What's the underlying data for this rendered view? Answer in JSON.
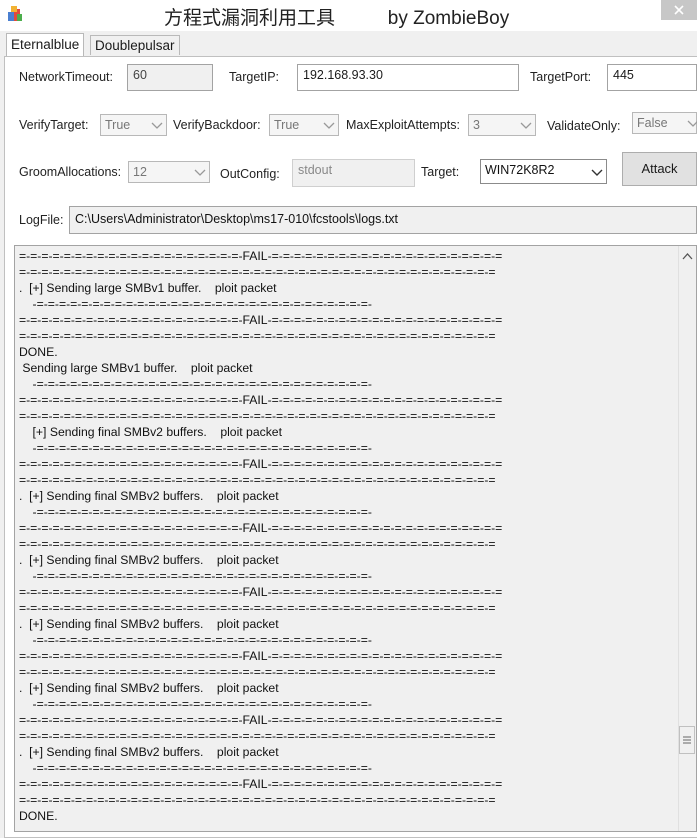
{
  "window": {
    "title": "方程式漏洞利用工具          by ZombieBoy"
  },
  "tabs": [
    {
      "label": "Eternalblue",
      "active": true
    },
    {
      "label": "Doublepulsar",
      "active": false
    }
  ],
  "form": {
    "network_timeout": {
      "label": "NetworkTimeout:",
      "value": "60"
    },
    "target_ip": {
      "label": "TargetIP:",
      "value": "192.168.93.30"
    },
    "target_port": {
      "label": "TargetPort:",
      "value": "445"
    },
    "verify_target": {
      "label": "VerifyTarget:",
      "value": "True"
    },
    "verify_backdoor": {
      "label": "VerifyBackdoor:",
      "value": "True"
    },
    "max_exploit_attempts": {
      "label": "MaxExploitAttempts:",
      "value": "3"
    },
    "validate_only": {
      "label": "ValidateOnly:",
      "value": "False"
    },
    "groom_allocations": {
      "label": "GroomAllocations:",
      "value": "12"
    },
    "out_config": {
      "label": "OutConfig:",
      "value": "stdout"
    },
    "target": {
      "label": "Target:",
      "value": "WIN72K8R2"
    },
    "attack_label": "Attack",
    "logfile": {
      "label": "LogFile:",
      "value": "C:\\Users\\Administrator\\Desktop\\ms17-010\\fcstools\\logs.txt"
    }
  },
  "log": {
    "lines": [
      "=-=-=-=-=-=-=-=-=-=-=-=-=-=-=-=-=-=-=-=-FAIL-=-=-=-=-=-=-=-=-=-=-=-=-=-=-=-=-=-=-=-=-=",
      "=-=-=-=-=-=-=-=-=-=-=-=-=-=-=-=-=-=-=-=-=-=-=-=-=-=-=-=-=-=-=-=-=-=-=-=-=-=-=-=-=-=-=",
      ".  [+] Sending large SMBv1 buffer.    ploit packet",
      "    -=-=-=-=-=-=-=-=-=-=-=-=-=-=-=-=-=-=-=-=-=-=-=-=-=-=-=-=-=-=-",
      "=-=-=-=-=-=-=-=-=-=-=-=-=-=-=-=-=-=-=-=-FAIL-=-=-=-=-=-=-=-=-=-=-=-=-=-=-=-=-=-=-=-=-=",
      "=-=-=-=-=-=-=-=-=-=-=-=-=-=-=-=-=-=-=-=-=-=-=-=-=-=-=-=-=-=-=-=-=-=-=-=-=-=-=-=-=-=-=",
      "DONE.",
      " Sending large SMBv1 buffer.    ploit packet",
      "    -=-=-=-=-=-=-=-=-=-=-=-=-=-=-=-=-=-=-=-=-=-=-=-=-=-=-=-=-=-=-",
      "=-=-=-=-=-=-=-=-=-=-=-=-=-=-=-=-=-=-=-=-FAIL-=-=-=-=-=-=-=-=-=-=-=-=-=-=-=-=-=-=-=-=-=",
      "=-=-=-=-=-=-=-=-=-=-=-=-=-=-=-=-=-=-=-=-=-=-=-=-=-=-=-=-=-=-=-=-=-=-=-=-=-=-=-=-=-=-=",
      "    [+] Sending final SMBv2 buffers.    ploit packet",
      "    -=-=-=-=-=-=-=-=-=-=-=-=-=-=-=-=-=-=-=-=-=-=-=-=-=-=-=-=-=-=-",
      "=-=-=-=-=-=-=-=-=-=-=-=-=-=-=-=-=-=-=-=-FAIL-=-=-=-=-=-=-=-=-=-=-=-=-=-=-=-=-=-=-=-=-=",
      "=-=-=-=-=-=-=-=-=-=-=-=-=-=-=-=-=-=-=-=-=-=-=-=-=-=-=-=-=-=-=-=-=-=-=-=-=-=-=-=-=-=-=",
      ".  [+] Sending final SMBv2 buffers.    ploit packet",
      "    -=-=-=-=-=-=-=-=-=-=-=-=-=-=-=-=-=-=-=-=-=-=-=-=-=-=-=-=-=-=-",
      "=-=-=-=-=-=-=-=-=-=-=-=-=-=-=-=-=-=-=-=-FAIL-=-=-=-=-=-=-=-=-=-=-=-=-=-=-=-=-=-=-=-=-=",
      "=-=-=-=-=-=-=-=-=-=-=-=-=-=-=-=-=-=-=-=-=-=-=-=-=-=-=-=-=-=-=-=-=-=-=-=-=-=-=-=-=-=-=",
      ".  [+] Sending final SMBv2 buffers.    ploit packet",
      "    -=-=-=-=-=-=-=-=-=-=-=-=-=-=-=-=-=-=-=-=-=-=-=-=-=-=-=-=-=-=-",
      "=-=-=-=-=-=-=-=-=-=-=-=-=-=-=-=-=-=-=-=-FAIL-=-=-=-=-=-=-=-=-=-=-=-=-=-=-=-=-=-=-=-=-=",
      "=-=-=-=-=-=-=-=-=-=-=-=-=-=-=-=-=-=-=-=-=-=-=-=-=-=-=-=-=-=-=-=-=-=-=-=-=-=-=-=-=-=-=",
      ".  [+] Sending final SMBv2 buffers.    ploit packet",
      "    -=-=-=-=-=-=-=-=-=-=-=-=-=-=-=-=-=-=-=-=-=-=-=-=-=-=-=-=-=-=-",
      "=-=-=-=-=-=-=-=-=-=-=-=-=-=-=-=-=-=-=-=-FAIL-=-=-=-=-=-=-=-=-=-=-=-=-=-=-=-=-=-=-=-=-=",
      "=-=-=-=-=-=-=-=-=-=-=-=-=-=-=-=-=-=-=-=-=-=-=-=-=-=-=-=-=-=-=-=-=-=-=-=-=-=-=-=-=-=-=",
      ".  [+] Sending final SMBv2 buffers.    ploit packet",
      "    -=-=-=-=-=-=-=-=-=-=-=-=-=-=-=-=-=-=-=-=-=-=-=-=-=-=-=-=-=-=-",
      "=-=-=-=-=-=-=-=-=-=-=-=-=-=-=-=-=-=-=-=-FAIL-=-=-=-=-=-=-=-=-=-=-=-=-=-=-=-=-=-=-=-=-=",
      "=-=-=-=-=-=-=-=-=-=-=-=-=-=-=-=-=-=-=-=-=-=-=-=-=-=-=-=-=-=-=-=-=-=-=-=-=-=-=-=-=-=-=",
      ".  [+] Sending final SMBv2 buffers.    ploit packet",
      "    -=-=-=-=-=-=-=-=-=-=-=-=-=-=-=-=-=-=-=-=-=-=-=-=-=-=-=-=-=-=-",
      "=-=-=-=-=-=-=-=-=-=-=-=-=-=-=-=-=-=-=-=-FAIL-=-=-=-=-=-=-=-=-=-=-=-=-=-=-=-=-=-=-=-=-=",
      "=-=-=-=-=-=-=-=-=-=-=-=-=-=-=-=-=-=-=-=-=-=-=-=-=-=-=-=-=-=-=-=-=-=-=-=-=-=-=-=-=-=-=",
      "DONE."
    ]
  },
  "icons": {
    "app": "app-icon",
    "close": "window-close-icon",
    "dropdown": "chevron-down-icon",
    "scroll_up": "scroll-up-arrow-icon",
    "scroll_thumb": "scrollbar-thumb-grip-icon"
  }
}
